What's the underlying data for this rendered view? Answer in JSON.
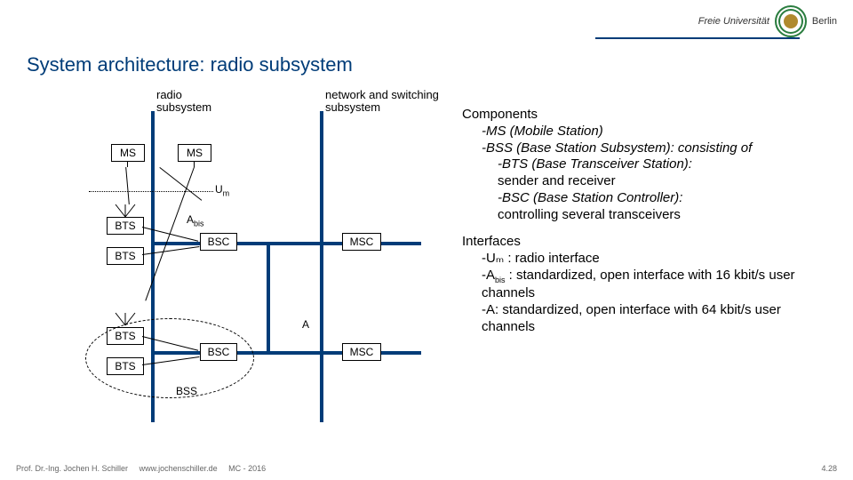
{
  "header": {
    "logo_left": "Freie Universität",
    "logo_right": "Berlin"
  },
  "title": "System architecture: radio subsystem",
  "diagram": {
    "radio_label_l1": "radio",
    "radio_label_l2": "subsystem",
    "net_label_l1": "network and switching",
    "net_label_l2": "subsystem",
    "ms": "MS",
    "bts": "BTS",
    "bsc": "BSC",
    "msc": "MSC",
    "bss": "BSS",
    "iface_um": "U",
    "iface_um_sub": "m",
    "iface_abis": "A",
    "iface_abis_sub": "bis",
    "iface_a": "A"
  },
  "content": {
    "comp_h": "Components",
    "comp_ms": "-MS (Mobile Station)",
    "comp_bss": "-BSS (Base Station Subsystem): consisting of",
    "comp_bts_l1": "-BTS (Base Transceiver Station):",
    "comp_bts_l2": "sender and receiver",
    "comp_bsc_l1": "-BSC (Base Station Controller):",
    "comp_bsc_l2": "controlling several transceivers",
    "if_h": "Interfaces",
    "if_um": "-Uₘ : radio interface",
    "if_abis_l1": "-A",
    "if_abis_sub": "bis",
    "if_abis_l2": " : standardized, open interface with 16 kbit/s user channels",
    "if_a": "-A: standardized, open interface with 64 kbit/s user channels"
  },
  "footer": {
    "author": "Prof. Dr.-Ing. Jochen H. Schiller",
    "url": "www.jochenschiller.de",
    "course": "MC - 2016",
    "page": "4.28"
  }
}
